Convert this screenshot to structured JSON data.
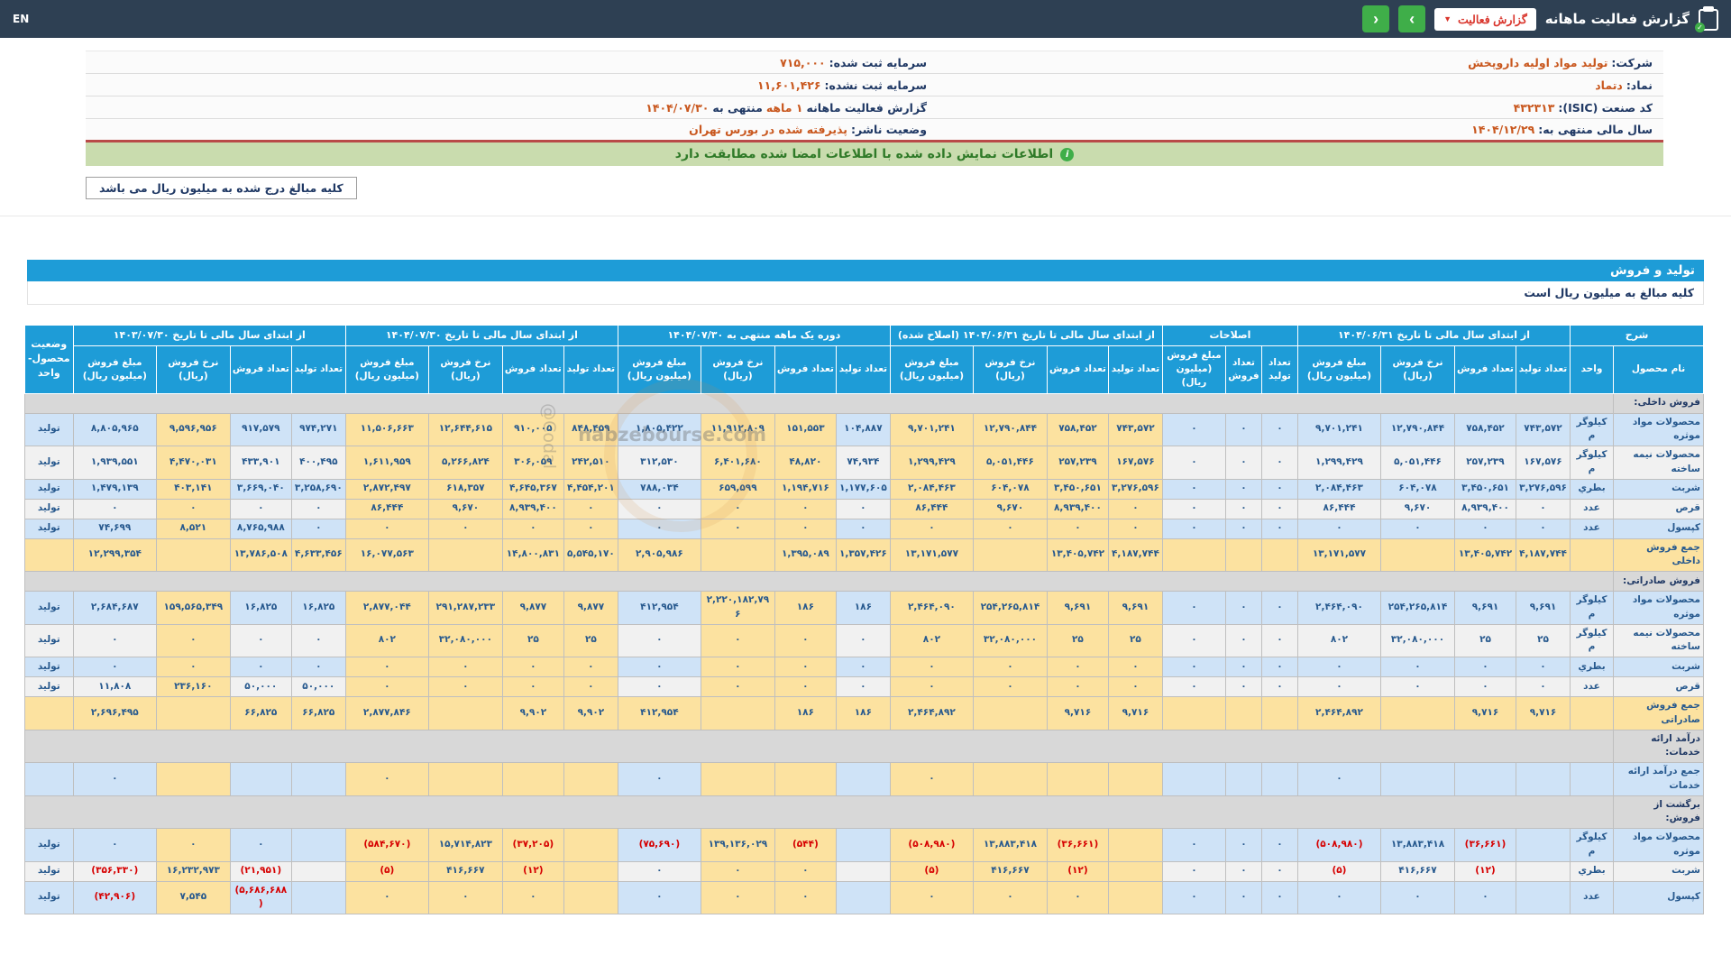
{
  "topbar": {
    "title": "گزارش فعالیت ماهانه",
    "dropdown_label": "گزارش فعالیت",
    "dropdown_caret": "▼",
    "next_arrow": "›",
    "prev_arrow": "‹",
    "en_label": "EN"
  },
  "info": {
    "company_label": "شرکت:",
    "company": "تولید مواد اولیه داروپخش",
    "symbol_label": "نماد:",
    "symbol": "دتماد",
    "isic_label": "کد صنعت (ISIC):",
    "isic": "۴۳۲۳۱۳",
    "fiscal_year_label": "سال مالی منتهی به:",
    "fiscal_year": "۱۴۰۴/۱۲/۲۹",
    "registered_capital_label": "سرمایه ثبت شده:",
    "registered_capital": "۷۱۵,۰۰۰",
    "unregistered_capital_label": "سرمایه ثبت نشده:",
    "unregistered_capital": "۱۱,۶۰۱,۴۲۶",
    "report_label": "گزارش فعالیت ماهانه",
    "report_period": "۱ ماهه",
    "report_middle": "منتهی به",
    "report_date": "۱۴۰۴/۰۷/۳۰",
    "publisher_status_label": "وضعیت ناشر:",
    "publisher_status": "پذیرفته شده در بورس تهران"
  },
  "notice": "اطلاعات نمایش داده شده با اطلاعات امضا شده مطابقت دارد",
  "amounts_note": "کلیه مبالغ درج شده به میلیون ریال می باشد",
  "section_title": "تولید و فروش",
  "section_subtitle": "کلیه مبالغ به میلیون ریال است",
  "watermark": {
    "site": "nabzebourse.com",
    "handle": "@Codal"
  },
  "colors": {
    "topbar_bg": "#2e4053",
    "accent_blue": "#1e9cd7",
    "button_green": "#3fae49",
    "dropdown_red": "#d9342b",
    "notice_bg": "#c9dcae",
    "notice_text": "#2f7a28",
    "row_blue": "#cfe3f7",
    "row_gray": "#f1f1f1",
    "highlight_yellow": "#fce2a0",
    "section_gray": "#d8d8d8",
    "value_orange": "#c9581f",
    "number_blue": "#27598e",
    "negative_red": "#d60000",
    "info_border_red": "#b94a48"
  },
  "table": {
    "desc_header": "شرح",
    "name_header": "نام محصول",
    "unit_header": "واحد",
    "status_header": "وضعیت محصول-واحد",
    "groups": [
      {
        "label": "از ابتدای سال مالی تا تاریخ ۱۴۰۴/۰۶/۳۱",
        "cols": [
          "تعداد تولید",
          "تعداد فروش",
          "نرخ فروش (ریال)",
          "مبلغ فروش (میلیون ریال)"
        ]
      },
      {
        "label": "اصلاحات",
        "cols": [
          "تعداد تولید",
          "تعداد فروش",
          "مبلغ فروش (میلیون ریال)"
        ]
      },
      {
        "label": "از ابتدای سال مالی تا تاریخ ۱۴۰۴/۰۶/۳۱ (اصلاح شده)",
        "cols": [
          "تعداد تولید",
          "تعداد فروش",
          "نرخ فروش (ریال)",
          "مبلغ فروش (میلیون ریال)"
        ]
      },
      {
        "label": "دوره یک ماهه منتهی به ۱۴۰۴/۰۷/۳۰",
        "cols": [
          "تعداد تولید",
          "تعداد فروش",
          "نرخ فروش (ریال)",
          "مبلغ فروش (میلیون ریال)"
        ]
      },
      {
        "label": "از ابتدای سال مالی تا تاریخ ۱۴۰۴/۰۷/۳۰",
        "cols": [
          "تعداد تولید",
          "تعداد فروش",
          "نرخ فروش (ریال)",
          "مبلغ فروش (میلیون ریال)"
        ]
      },
      {
        "label": "از ابتدای سال مالی تا تاریخ ۱۴۰۳/۰۷/۳۰",
        "cols": [
          "تعداد تولید",
          "تعداد فروش",
          "نرخ فروش (ریال)",
          "مبلغ فروش (میلیون ریال)"
        ]
      }
    ],
    "rows": [
      {
        "type": "section",
        "name": "فروش داخلی:"
      },
      {
        "type": "data",
        "name": "محصولات مواد موثره",
        "unit": "کیلوگرم",
        "status": "تولید",
        "cells": [
          "۷۴۳,۵۷۲",
          "۷۵۸,۴۵۲",
          "۱۲,۷۹۰,۸۴۴",
          "۹,۷۰۱,۲۴۱",
          "۰",
          "۰",
          "۰",
          "۷۴۳,۵۷۲",
          "۷۵۸,۴۵۲",
          "۱۲,۷۹۰,۸۴۴",
          "۹,۷۰۱,۲۴۱",
          "۱۰۴,۸۸۷",
          "۱۵۱,۵۵۳",
          "۱۱,۹۱۲,۸۰۹",
          "۱,۸۰۵,۴۲۲",
          "۸۴۸,۴۵۹",
          "۹۱۰,۰۰۵",
          "۱۲,۶۴۴,۶۱۵",
          "۱۱,۵۰۶,۶۶۳",
          "۹۷۴,۲۷۱",
          "۹۱۷,۵۷۹",
          "۹,۵۹۶,۹۵۶",
          "۸,۸۰۵,۹۶۵"
        ]
      },
      {
        "type": "data",
        "name": "محصولات نیمه ساخته",
        "unit": "کیلوگرم",
        "status": "تولید",
        "cells": [
          "۱۶۷,۵۷۶",
          "۲۵۷,۲۳۹",
          "۵,۰۵۱,۴۴۶",
          "۱,۲۹۹,۴۲۹",
          "۰",
          "۰",
          "۰",
          "۱۶۷,۵۷۶",
          "۲۵۷,۲۳۹",
          "۵,۰۵۱,۴۴۶",
          "۱,۲۹۹,۴۲۹",
          "۷۴,۹۳۴",
          "۴۸,۸۲۰",
          "۶,۴۰۱,۶۸۰",
          "۳۱۲,۵۳۰",
          "۲۴۲,۵۱۰",
          "۳۰۶,۰۵۹",
          "۵,۲۶۶,۸۲۴",
          "۱,۶۱۱,۹۵۹",
          "۴۰۰,۴۹۵",
          "۴۳۳,۹۰۱",
          "۴,۴۷۰,۰۳۱",
          "۱,۹۳۹,۵۵۱"
        ]
      },
      {
        "type": "data",
        "name": "شربت",
        "unit": "بطري",
        "status": "تولید",
        "cells": [
          "۳,۲۷۶,۵۹۶",
          "۳,۴۵۰,۶۵۱",
          "۶۰۴,۰۷۸",
          "۲,۰۸۴,۴۶۳",
          "۰",
          "۰",
          "۰",
          "۳,۲۷۶,۵۹۶",
          "۳,۴۵۰,۶۵۱",
          "۶۰۴,۰۷۸",
          "۲,۰۸۴,۴۶۳",
          "۱,۱۷۷,۶۰۵",
          "۱,۱۹۴,۷۱۶",
          "۶۵۹,۵۹۹",
          "۷۸۸,۰۳۴",
          "۴,۴۵۴,۲۰۱",
          "۴,۶۴۵,۳۶۷",
          "۶۱۸,۳۵۷",
          "۲,۸۷۲,۴۹۷",
          "۳,۲۵۸,۶۹۰",
          "۳,۶۶۹,۰۴۰",
          "۴۰۳,۱۴۱",
          "۱,۴۷۹,۱۳۹"
        ]
      },
      {
        "type": "data",
        "name": "قرص",
        "unit": "عدد",
        "status": "تولید",
        "cells": [
          "۰",
          "۸,۹۳۹,۴۰۰",
          "۹,۶۷۰",
          "۸۶,۴۴۴",
          "۰",
          "۰",
          "۰",
          "۰",
          "۸,۹۳۹,۴۰۰",
          "۹,۶۷۰",
          "۸۶,۴۴۴",
          "۰",
          "۰",
          "۰",
          "۰",
          "۰",
          "۸,۹۳۹,۴۰۰",
          "۹,۶۷۰",
          "۸۶,۴۴۴",
          "۰",
          "۰",
          "۰",
          "۰"
        ]
      },
      {
        "type": "data",
        "name": "کپسول",
        "unit": "عدد",
        "status": "تولید",
        "cells": [
          "۰",
          "۰",
          "۰",
          "۰",
          "۰",
          "۰",
          "۰",
          "۰",
          "۰",
          "۰",
          "۰",
          "۰",
          "۰",
          "۰",
          "۰",
          "۰",
          "۰",
          "۰",
          "۰",
          "۰",
          "۸,۷۶۵,۹۸۸",
          "۸,۵۲۱",
          "۷۴,۶۹۹"
        ]
      },
      {
        "type": "sum",
        "name": "جمع فروش داخلی",
        "unit": "",
        "status": "",
        "cells": [
          "۴,۱۸۷,۷۴۴",
          "۱۳,۴۰۵,۷۴۲",
          "",
          "۱۳,۱۷۱,۵۷۷",
          "",
          "",
          "",
          "۴,۱۸۷,۷۴۴",
          "۱۳,۴۰۵,۷۴۲",
          "",
          "۱۳,۱۷۱,۵۷۷",
          "۱,۳۵۷,۴۲۶",
          "۱,۳۹۵,۰۸۹",
          "",
          "۲,۹۰۵,۹۸۶",
          "۵,۵۴۵,۱۷۰",
          "۱۴,۸۰۰,۸۳۱",
          "",
          "۱۶,۰۷۷,۵۶۳",
          "۴,۶۳۳,۴۵۶",
          "۱۳,۷۸۶,۵۰۸",
          "",
          "۱۲,۲۹۹,۳۵۴"
        ]
      },
      {
        "type": "section",
        "name": "فروش صادراتی:"
      },
      {
        "type": "data",
        "name": "محصولات مواد موثره",
        "unit": "کیلوگرم",
        "status": "تولید",
        "cells": [
          "۹,۶۹۱",
          "۹,۶۹۱",
          "۲۵۴,۲۶۵,۸۱۴",
          "۲,۴۶۴,۰۹۰",
          "۰",
          "۰",
          "۰",
          "۹,۶۹۱",
          "۹,۶۹۱",
          "۲۵۴,۲۶۵,۸۱۴",
          "۲,۴۶۴,۰۹۰",
          "۱۸۶",
          "۱۸۶",
          "۲,۲۲۰,۱۸۲,۷۹۶",
          "۴۱۲,۹۵۴",
          "۹,۸۷۷",
          "۹,۸۷۷",
          "۲۹۱,۲۸۷,۲۳۳",
          "۲,۸۷۷,۰۴۴",
          "۱۶,۸۲۵",
          "۱۶,۸۲۵",
          "۱۵۹,۵۶۵,۳۴۹",
          "۲,۶۸۴,۶۸۷"
        ]
      },
      {
        "type": "data",
        "name": "محصولات نیمه ساخته",
        "unit": "کیلوگرم",
        "status": "تولید",
        "cells": [
          "۲۵",
          "۲۵",
          "۳۲,۰۸۰,۰۰۰",
          "۸۰۲",
          "۰",
          "۰",
          "۰",
          "۲۵",
          "۲۵",
          "۳۲,۰۸۰,۰۰۰",
          "۸۰۲",
          "۰",
          "۰",
          "۰",
          "۰",
          "۲۵",
          "۲۵",
          "۳۲,۰۸۰,۰۰۰",
          "۸۰۲",
          "۰",
          "۰",
          "۰",
          "۰"
        ]
      },
      {
        "type": "data",
        "name": "شربت",
        "unit": "بطري",
        "status": "تولید",
        "cells": [
          "۰",
          "۰",
          "۰",
          "۰",
          "۰",
          "۰",
          "۰",
          "۰",
          "۰",
          "۰",
          "۰",
          "۰",
          "۰",
          "۰",
          "۰",
          "۰",
          "۰",
          "۰",
          "۰",
          "۰",
          "۰",
          "۰",
          "۰"
        ]
      },
      {
        "type": "data",
        "name": "قرص",
        "unit": "عدد",
        "status": "تولید",
        "cells": [
          "۰",
          "۰",
          "۰",
          "۰",
          "۰",
          "۰",
          "۰",
          "۰",
          "۰",
          "۰",
          "۰",
          "۰",
          "۰",
          "۰",
          "۰",
          "۰",
          "۰",
          "۰",
          "۰",
          "۵۰,۰۰۰",
          "۵۰,۰۰۰",
          "۲۳۶,۱۶۰",
          "۱۱,۸۰۸"
        ]
      },
      {
        "type": "sum",
        "name": "جمع فروش صادراتی",
        "unit": "",
        "status": "",
        "cells": [
          "۹,۷۱۶",
          "۹,۷۱۶",
          "",
          "۲,۴۶۴,۸۹۲",
          "",
          "",
          "",
          "۹,۷۱۶",
          "۹,۷۱۶",
          "",
          "۲,۴۶۴,۸۹۲",
          "۱۸۶",
          "۱۸۶",
          "",
          "۴۱۲,۹۵۴",
          "۹,۹۰۲",
          "۹,۹۰۲",
          "",
          "۲,۸۷۷,۸۴۶",
          "۶۶,۸۲۵",
          "۶۶,۸۲۵",
          "",
          "۲,۶۹۶,۴۹۵"
        ]
      },
      {
        "type": "section",
        "name": "درآمد ارائه خدمات:"
      },
      {
        "type": "data",
        "name": "جمع درآمد ارائه خدمات",
        "unit": "",
        "status": "",
        "cells": [
          "",
          "",
          "",
          "۰",
          "",
          "",
          "",
          "",
          "",
          "",
          "۰",
          "",
          "",
          "",
          "۰",
          "",
          "",
          "",
          "۰",
          "",
          "",
          "",
          "۰"
        ]
      },
      {
        "type": "section",
        "name": "برگشت از فروش:"
      },
      {
        "type": "data",
        "name": "محصولات مواد موثره",
        "unit": "کیلوگرم",
        "status": "تولید",
        "cells": [
          "",
          "(۳۶,۶۶۱)",
          "۱۳,۸۸۳,۴۱۸",
          "(۵۰۸,۹۸۰)",
          "۰",
          "۰",
          "۰",
          "",
          "(۳۶,۶۶۱)",
          "۱۳,۸۸۳,۴۱۸",
          "(۵۰۸,۹۸۰)",
          "",
          "(۵۴۴)",
          "۱۳۹,۱۳۶,۰۲۹",
          "(۷۵,۶۹۰)",
          "",
          "(۳۷,۲۰۵)",
          "۱۵,۷۱۴,۸۲۳",
          "(۵۸۴,۶۷۰)",
          "",
          "۰",
          "۰",
          "۰"
        ]
      },
      {
        "type": "data",
        "name": "شربت",
        "unit": "بطري",
        "status": "تولید",
        "cells": [
          "",
          "(۱۲)",
          "۴۱۶,۶۶۷",
          "(۵)",
          "۰",
          "۰",
          "۰",
          "",
          "(۱۲)",
          "۴۱۶,۶۶۷",
          "(۵)",
          "",
          "۰",
          "۰",
          "۰",
          "",
          "(۱۲)",
          "۴۱۶,۶۶۷",
          "(۵)",
          "",
          "(۲۱,۹۵۱)",
          "۱۶,۲۳۲,۹۷۳",
          "(۳۵۶,۳۳۰)"
        ]
      },
      {
        "type": "data",
        "name": "کپسول",
        "unit": "عدد",
        "status": "تولید",
        "cells": [
          "",
          "۰",
          "۰",
          "۰",
          "۰",
          "۰",
          "۰",
          "",
          "۰",
          "۰",
          "۰",
          "",
          "۰",
          "۰",
          "۰",
          "",
          "۰",
          "۰",
          "۰",
          "",
          "(۵,۶۸۶,۶۸۸)",
          "۷,۵۴۵",
          "(۴۲,۹۰۶)"
        ]
      }
    ]
  }
}
